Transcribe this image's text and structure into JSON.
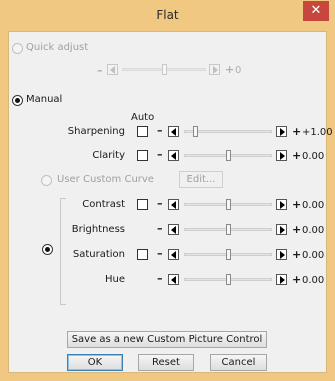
{
  "window": {
    "title": "Flat",
    "close_glyph": "✕"
  },
  "quick_adjust": {
    "label": "Quick adjust",
    "minus": "–",
    "plus": "+",
    "value": "0",
    "position": 0.5
  },
  "manual": {
    "label": "Manual",
    "auto_header": "Auto"
  },
  "sharpening": {
    "label": "Sharpening",
    "minus": "–",
    "plus": "+",
    "value": "+1.00",
    "position": 0.11
  },
  "clarity": {
    "label": "Clarity",
    "minus": "–",
    "plus": "+",
    "value": "0.00",
    "position": 0.5
  },
  "custom_curve": {
    "label": "User Custom Curve",
    "edit_label": "Edit..."
  },
  "contrast": {
    "label": "Contrast",
    "minus": "–",
    "plus": "+",
    "value": "0.00",
    "position": 0.5
  },
  "brightness": {
    "label": "Brightness",
    "minus": "–",
    "plus": "+",
    "value": "0.00",
    "position": 0.5
  },
  "saturation": {
    "label": "Saturation",
    "minus": "–",
    "plus": "+",
    "value": "0.00",
    "position": 0.5
  },
  "hue": {
    "label": "Hue",
    "minus": "–",
    "plus": "+",
    "value": "0.00",
    "position": 0.5
  },
  "buttons": {
    "save_custom": "Save as a new Custom Picture Control",
    "ok": "OK",
    "reset": "Reset",
    "cancel": "Cancel"
  },
  "icons": {
    "close": "close-icon",
    "left": "arrow-left-icon",
    "right": "arrow-right-icon"
  }
}
